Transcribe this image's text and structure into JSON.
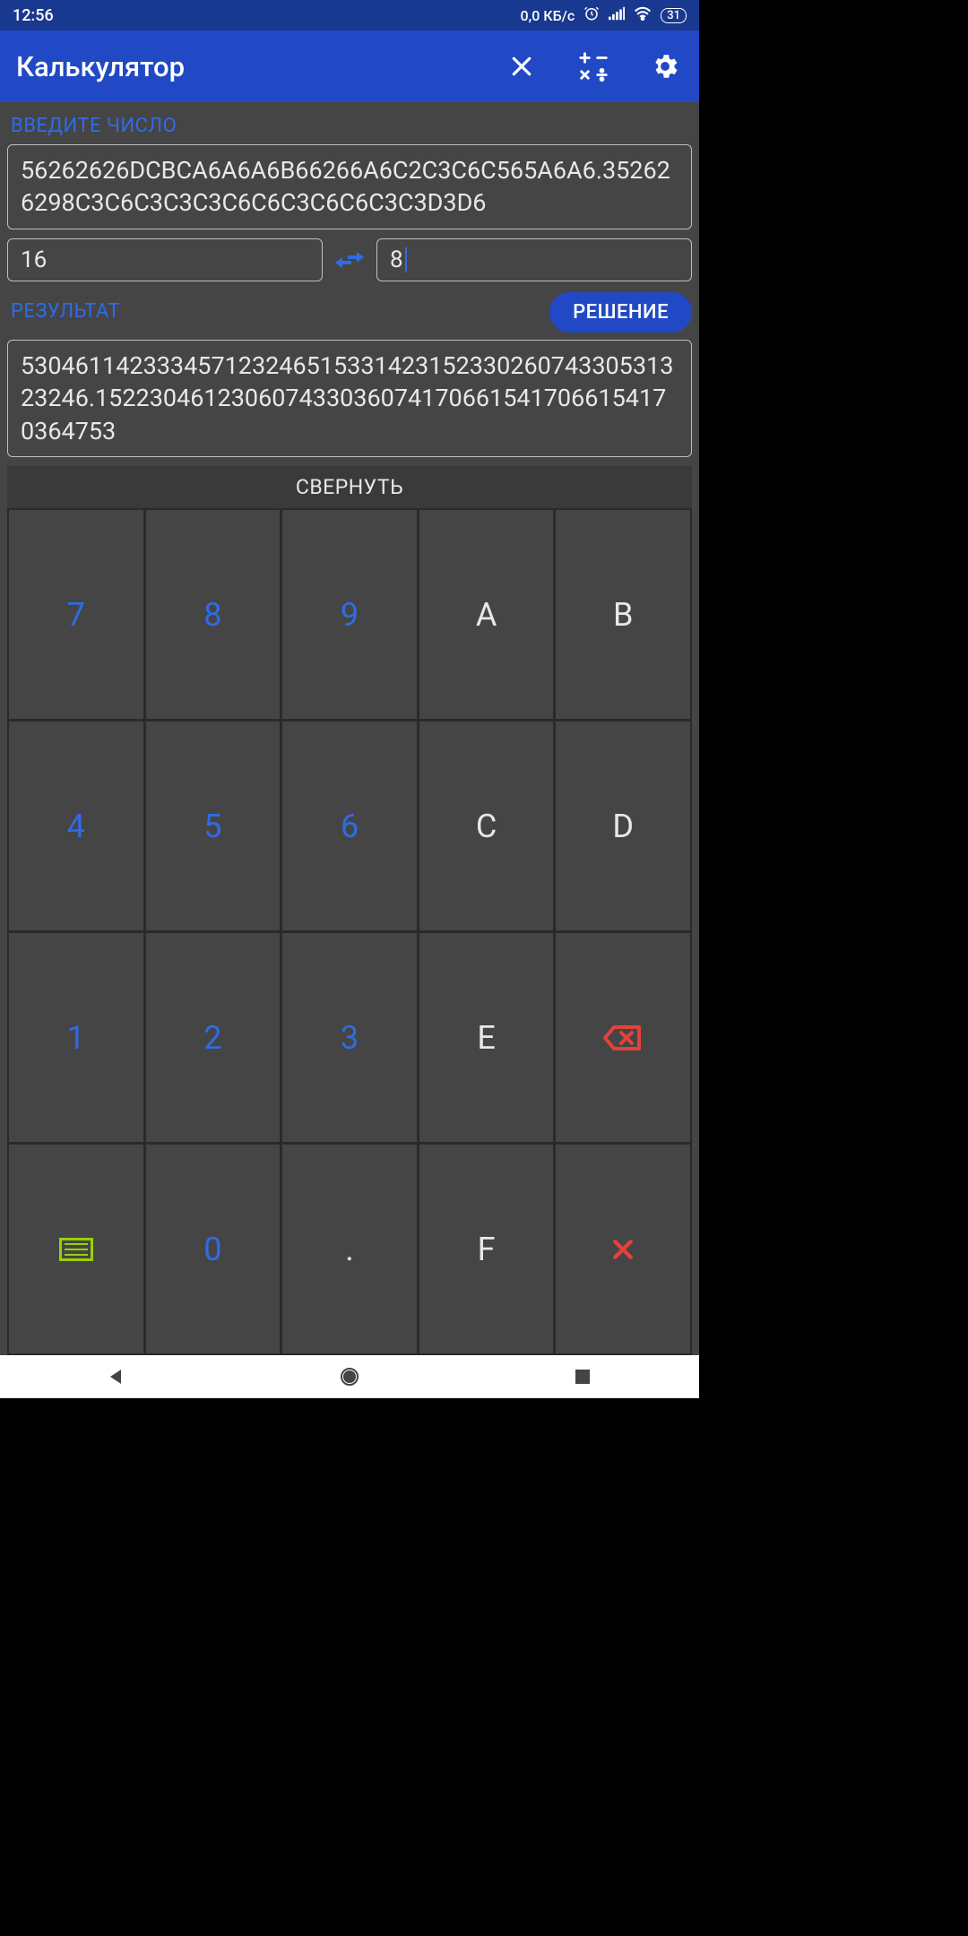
{
  "status": {
    "time": "12:56",
    "net": "0,0 КБ/с",
    "battery": "31"
  },
  "appbar": {
    "title": "Калькулятор"
  },
  "input": {
    "label": "ВВЕДИТЕ ЧИСЛО",
    "value": "56262626DCBCA6A6A6B66266A6C2C3C6C565A6A6.352626298C3C6C3C3C3C6C6C3C6C6C3C3D3D6"
  },
  "bases": {
    "from": "16",
    "to": "8"
  },
  "result": {
    "label": "РЕЗУЛЬТАТ",
    "solution_btn": "РЕШЕНИЕ",
    "value": "5304611423334571232465153314231523302607433053132​3246.15223046123060743303607417066154170661541​70364753"
  },
  "collapse": "СВЕРНУТЬ",
  "keys": {
    "r0": [
      "7",
      "8",
      "9",
      "A",
      "B"
    ],
    "r1": [
      "4",
      "5",
      "6",
      "C",
      "D"
    ],
    "r2": [
      "1",
      "2",
      "3",
      "E",
      ""
    ],
    "r3": [
      "",
      "0",
      ".",
      "F",
      ""
    ]
  }
}
